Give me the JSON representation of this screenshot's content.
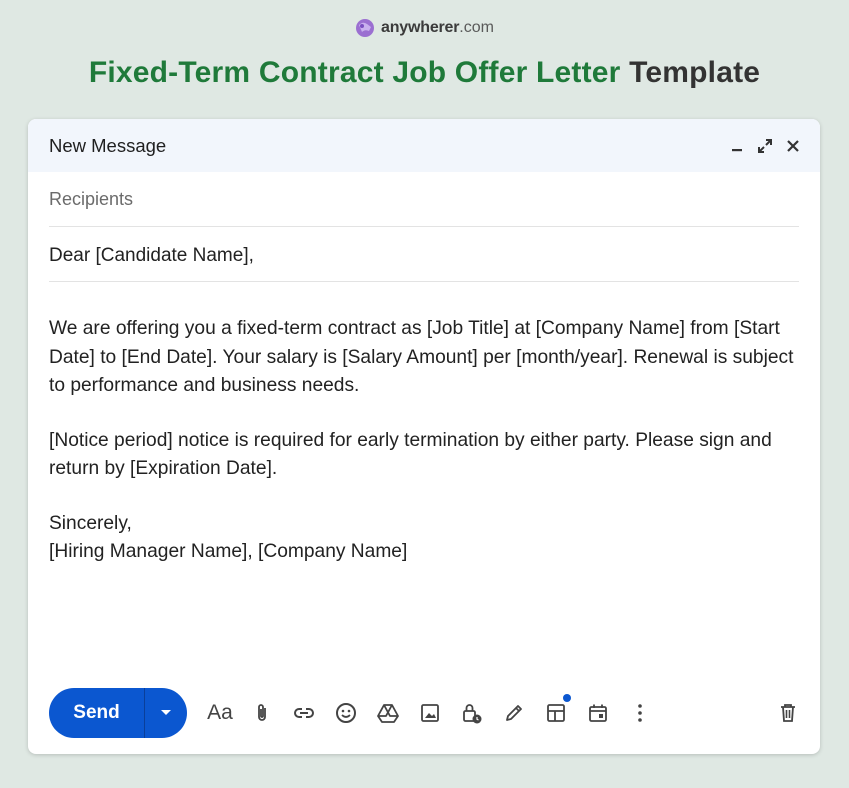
{
  "brand": {
    "name_bold": "anywherer",
    "name_suffix": ".com"
  },
  "headline": {
    "green_part": "Fixed-Term Contract Job Offer Letter",
    "dark_part": "Template"
  },
  "window": {
    "title": "New Message",
    "recipients_placeholder": "Recipients",
    "subject": "Dear [Candidate Name],",
    "body": {
      "paragraph_1": "We are offering you a fixed-term contract as [Job Title] at [Company Name] from [Start Date] to [End Date]. Your salary is [Salary Amount] per [month/year]. Renewal is subject to performance and business needs.",
      "paragraph_2": "[Notice period] notice is required for early termination by either party. Please sign and return by [Expiration Date].",
      "closing": "Sincerely,",
      "signature": "[Hiring Manager Name], [Company Name]"
    },
    "toolbar": {
      "send_label": "Send",
      "format_label": "Aa",
      "accent_color": "#0b57d0"
    }
  },
  "colors": {
    "background": "#dfe8e3",
    "headline_green": "#1f7a3a",
    "titlebar": "#f2f6fc"
  }
}
